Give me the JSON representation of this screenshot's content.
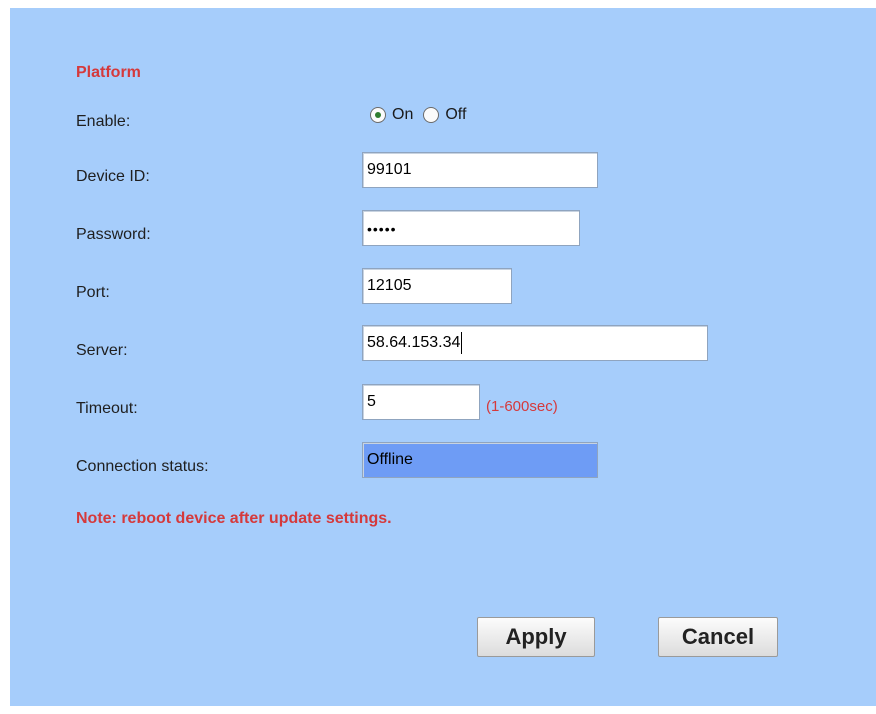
{
  "platform": {
    "title": "Platform",
    "enable": {
      "label": "Enable:",
      "options": [
        {
          "label": "On",
          "selected": true
        },
        {
          "label": "Off",
          "selected": false
        }
      ]
    },
    "device_id": {
      "label": "Device ID:",
      "value": "99101"
    },
    "password": {
      "label": "Password:",
      "value": "•••••"
    },
    "port": {
      "label": "Port:",
      "value": "12105"
    },
    "server": {
      "label": "Server:",
      "value": "58.64.153.34"
    },
    "timeout": {
      "label": "Timeout:",
      "value": "5",
      "hint": "(1-600sec)"
    },
    "connection_status": {
      "label": "Connection status:",
      "value": "Offline"
    },
    "note": "Note: reboot device after update settings."
  },
  "actions": {
    "apply": "Apply",
    "cancel": "Cancel"
  },
  "colors": {
    "panel_background": "#a6cdfb",
    "accent_red": "#d5393b",
    "status_highlight": "#6e9cf5"
  }
}
